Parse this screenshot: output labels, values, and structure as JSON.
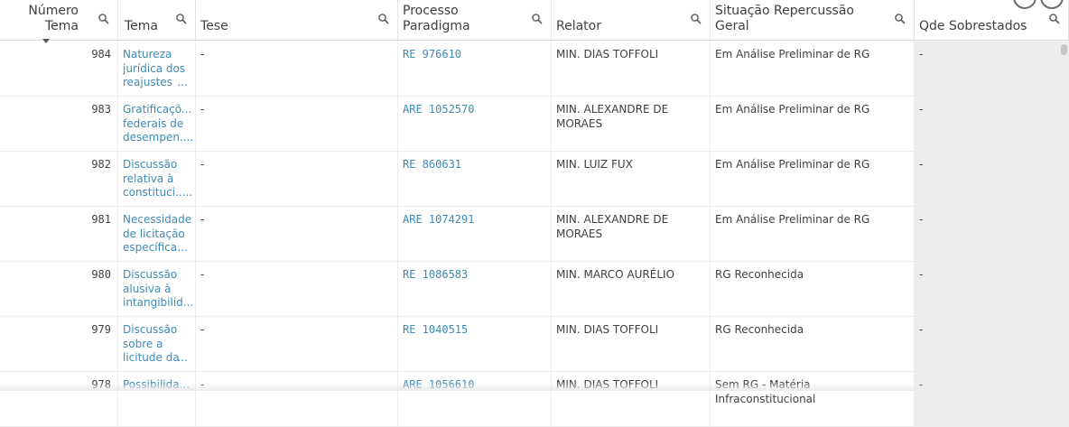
{
  "columns": [
    {
      "key": "numero",
      "label": "Número\nTema",
      "icon": "search-icon"
    },
    {
      "key": "tema",
      "label": "Tema",
      "icon": "search-icon"
    },
    {
      "key": "tese",
      "label": "Tese",
      "icon": "search-icon"
    },
    {
      "key": "processo",
      "label": "Processo\nParadigma",
      "icon": "search-icon"
    },
    {
      "key": "relator",
      "label": "Relator",
      "icon": "search-icon"
    },
    {
      "key": "situacao",
      "label": "Situação Repercussão\nGeral",
      "icon": "search-icon"
    },
    {
      "key": "qde",
      "label": "Qde Sobrestados",
      "icon": "search-icon"
    }
  ],
  "sort_indicator": "sort-descending-icon",
  "rows": [
    {
      "numero": "984",
      "tema": [
        "Natureza",
        "jurídica dos",
        "reajustes"
      ],
      "tema_more": "...",
      "tese": "-",
      "processo": "RE 976610",
      "relator": [
        "MIN. DIAS TOFFOLI"
      ],
      "situacao": "Em Análise Preliminar de RG",
      "qde": "-"
    },
    {
      "numero": "983",
      "tema": [
        "Gratificaçõ...",
        "federais de",
        "desempen...."
      ],
      "tema_more": "",
      "tese": "-",
      "processo": "ARE 1052570",
      "relator": [
        "MIN. ALEXANDRE DE",
        "MORAES"
      ],
      "situacao": "Em Análise Preliminar de RG",
      "qde": "-"
    },
    {
      "numero": "982",
      "tema": [
        "Discussão",
        "relativa à",
        "constituci....."
      ],
      "tema_more": "",
      "tese": "-",
      "processo": "RE 860631",
      "relator": [
        "MIN. LUIZ FUX"
      ],
      "situacao": "Em Análise Preliminar de RG",
      "qde": "-"
    },
    {
      "numero": "981",
      "tema": [
        "Necessidade",
        "de licitação",
        "específica"
      ],
      "tema_more": "...",
      "tese": "-",
      "processo": "ARE 1074291",
      "relator": [
        "MIN. ALEXANDRE DE",
        "MORAES"
      ],
      "situacao": "Em Análise Preliminar de RG",
      "qde": "-"
    },
    {
      "numero": "980",
      "tema": [
        "Discussão",
        "alusiva à",
        "intangibilid..."
      ],
      "tema_more": "",
      "tese": "-",
      "processo": "RE 1086583",
      "relator": [
        "MIN. MARCO AURÉLIO"
      ],
      "situacao": "RG Reconhecida",
      "qde": "-"
    },
    {
      "numero": "979",
      "tema": [
        "Discussão",
        "sobre a",
        "licitude da"
      ],
      "tema_more": "...",
      "tese": "-",
      "processo": "RE 1040515",
      "relator": [
        "MIN. DIAS TOFFOLI"
      ],
      "situacao": "RG Reconhecida",
      "qde": "-"
    },
    {
      "numero": "978",
      "tema": [
        "Possibilida..."
      ],
      "tema_more": "",
      "tese": "-",
      "processo": "ARE 1056610",
      "relator": [
        "MIN. DIAS TOFFOLI"
      ],
      "situacao": "Sem RG - Matéria Infraconstitucional",
      "qde": "-"
    }
  ]
}
